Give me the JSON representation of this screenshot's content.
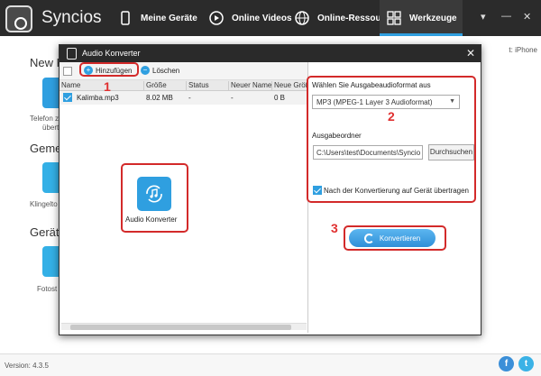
{
  "app": {
    "title": "Syncios"
  },
  "nav": [
    {
      "label": "Meine Geräte",
      "icon": "phone-icon"
    },
    {
      "label": "Online Videos",
      "icon": "play-icon"
    },
    {
      "label": "Online-Ressourcen",
      "icon": "globe-icon"
    },
    {
      "label": "Werkzeuge",
      "icon": "grid-icon",
      "active": true
    }
  ],
  "window_controls": {
    "menu": "▾",
    "minimize": "—",
    "close": "✕"
  },
  "background": {
    "section1": "New F",
    "section1_caption": [
      "Telefon z",
      "übert"
    ],
    "section2": "Geme",
    "section2_caption": "Klingelto",
    "section3": "Gerät",
    "section3_caption": "Fotost",
    "right_partial": "t: iPhone"
  },
  "status": {
    "version": "Version: 4.3.5"
  },
  "social": {
    "facebook": "f",
    "twitter": "t"
  },
  "dialog": {
    "title": "Audio Konverter",
    "close": "✕",
    "toolbar": {
      "add": "Hinzufügen",
      "delete": "Löschen"
    },
    "columns": [
      "Name",
      "Größe",
      "Status",
      "Neuer Name",
      "Neue Größ"
    ],
    "rows": [
      {
        "name": "Kalimba.mp3",
        "size": "8.02 MB",
        "status": "-",
        "new_name": "-",
        "new_size": "0 B"
      }
    ],
    "tile_label": "Audio Konverter",
    "format_label": "Wählen Sie Ausgabeaudioformat aus",
    "format_value": "MP3 (MPEG-1 Layer 3 Audioformat)",
    "folder_label": "Ausgabeordner",
    "folder_value": "C:\\Users\\test\\Documents\\Syncio",
    "browse": "Durchsuchen",
    "transfer_checkbox": "Nach der Konvertierung auf Gerät übertragen",
    "convert": "Konvertieren"
  },
  "callouts": {
    "n1": "1",
    "n2": "2",
    "n3": "3"
  },
  "colors": {
    "accent": "#2f9fe0",
    "callout": "#d32a2a",
    "topbar": "#2b2b2b"
  }
}
